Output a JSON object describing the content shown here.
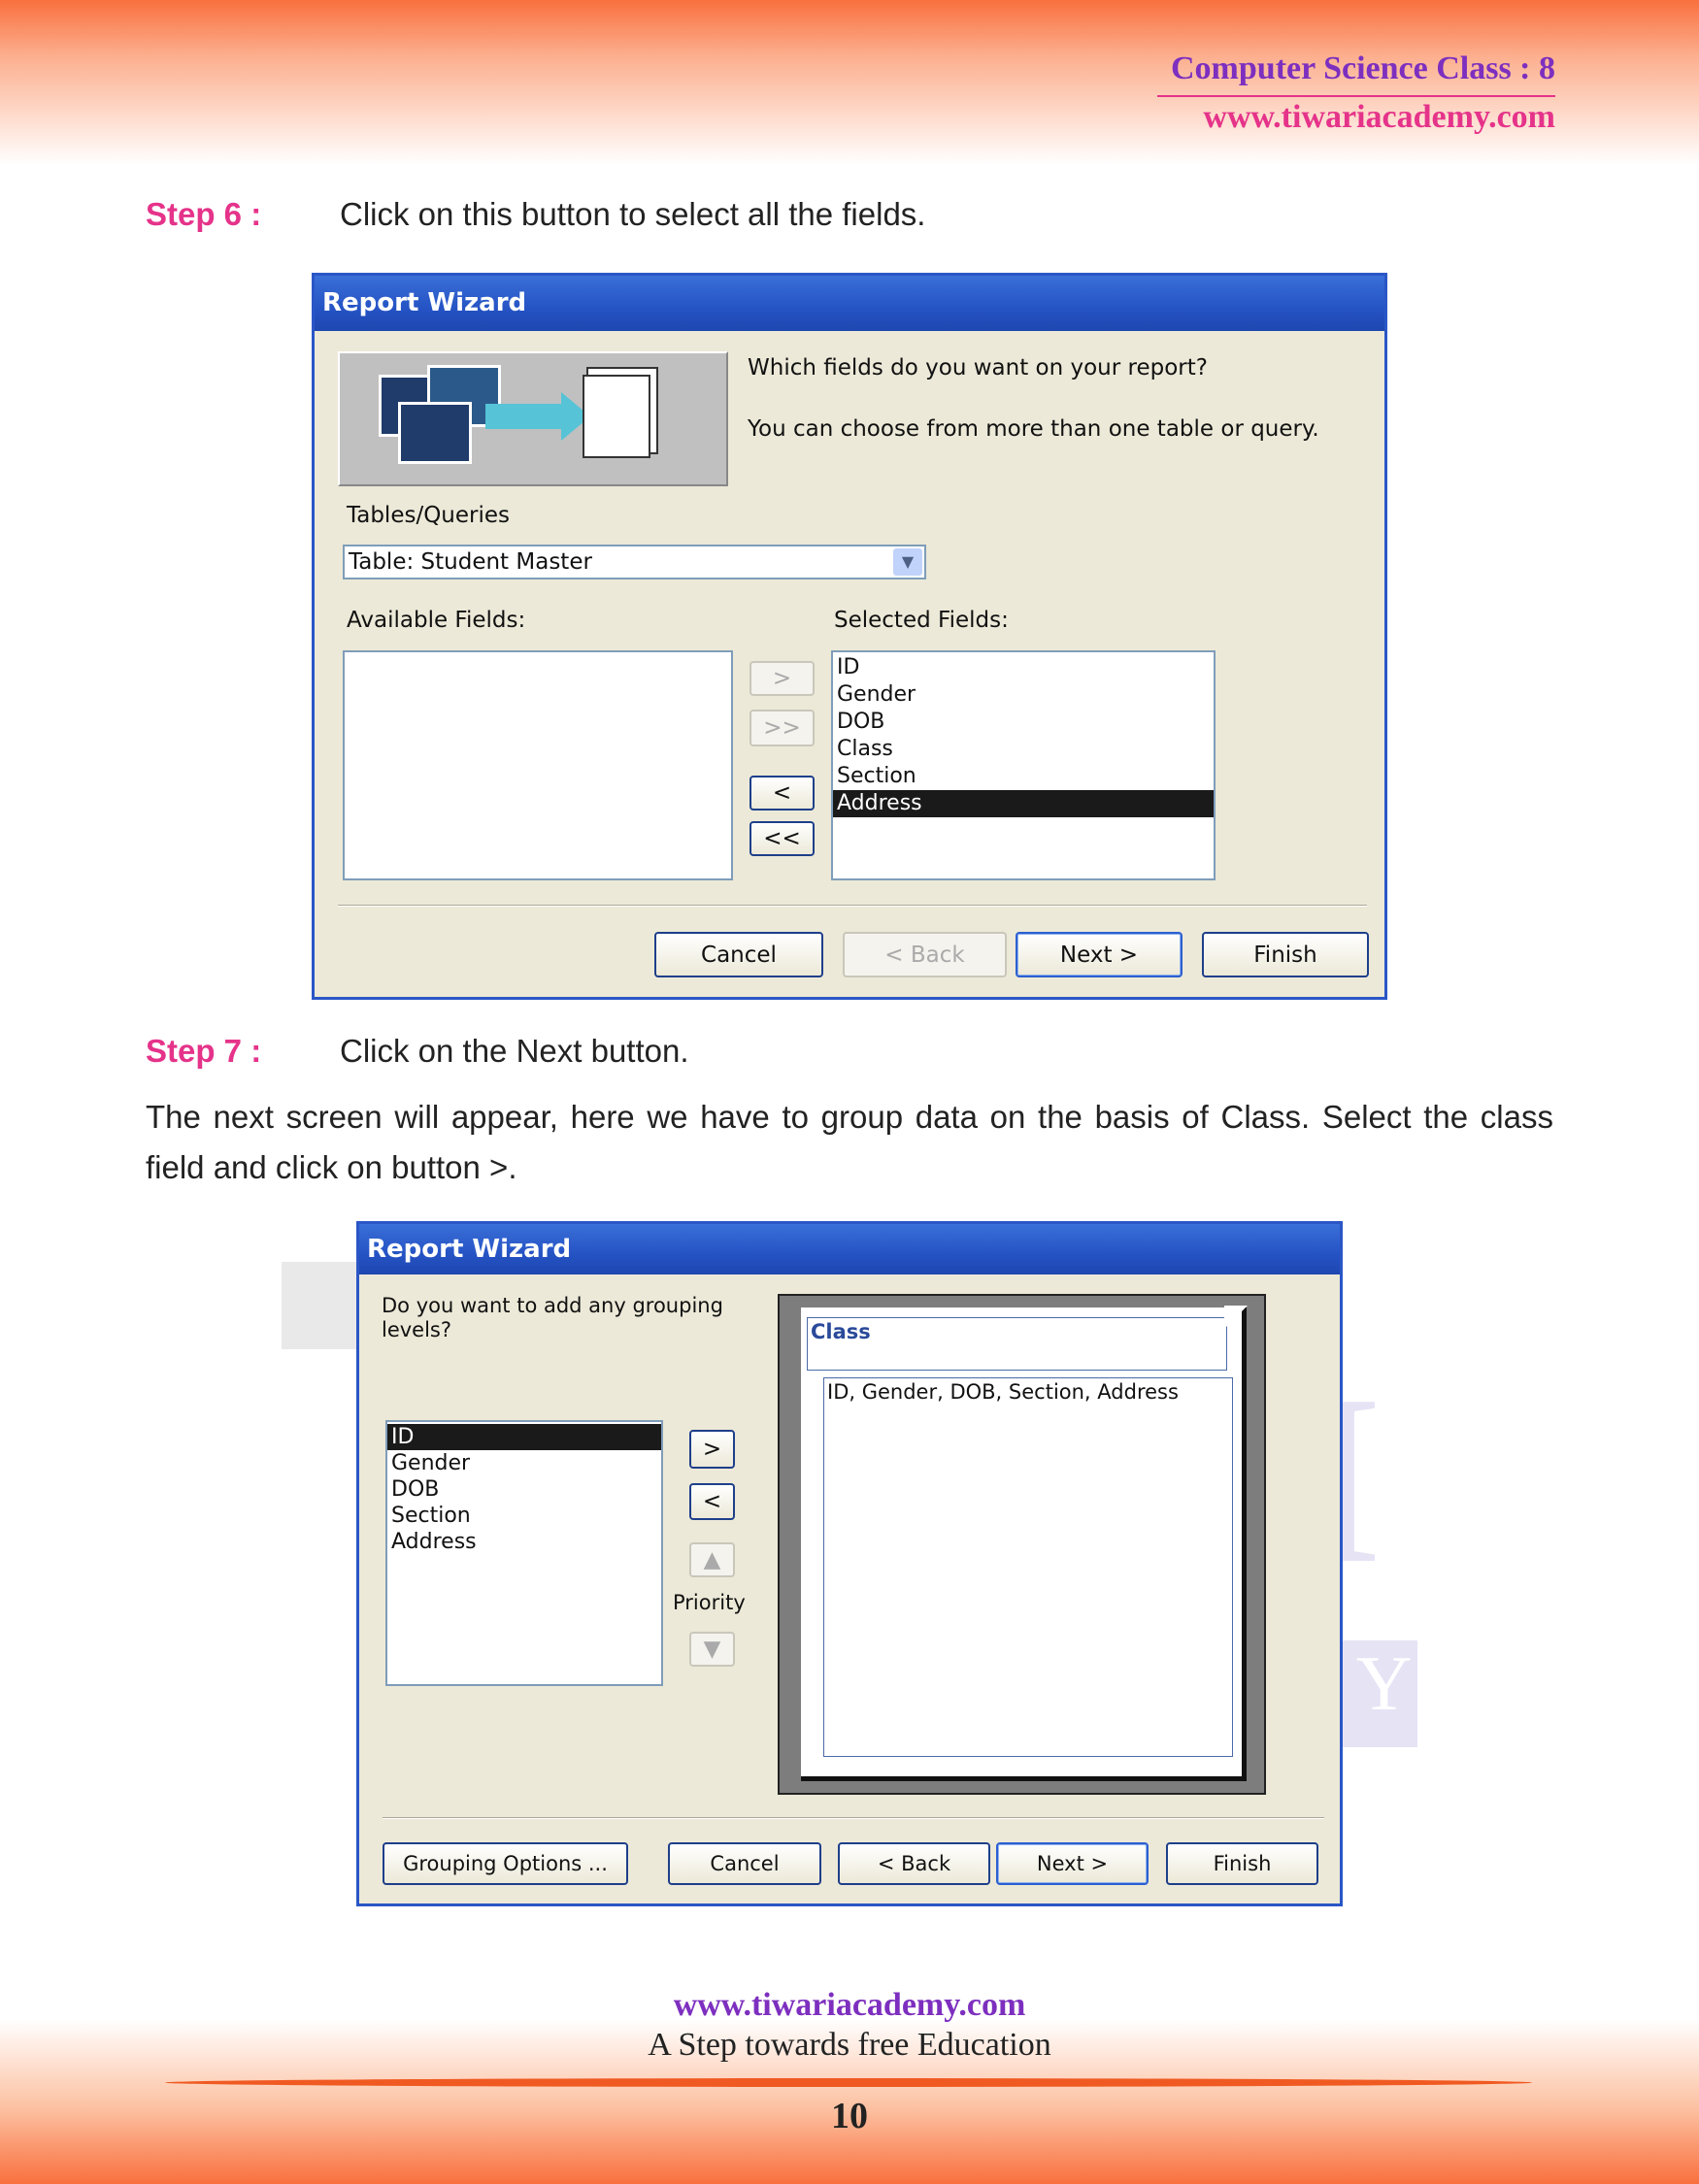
{
  "header": {
    "subject": "Computer Science Class : 8",
    "website": "www.tiwariacademy.com",
    "subject_color": "#7d2fbf",
    "website_color": "#e5338a"
  },
  "watermark": {
    "line1": "TIWARI",
    "line2": "ACADEMY"
  },
  "step6": {
    "label": "Step 6 :",
    "text": "Click on this button to select all the fields."
  },
  "dialog1": {
    "title": "Report Wizard",
    "question": "Which fields do you want on your report?",
    "hint": "You can choose from more than one table or query.",
    "tables_label": "Tables/Queries",
    "combo_value": "Table: Student Master",
    "available_label": "Available Fields:",
    "selected_label": "Selected Fields:",
    "available_fields": [],
    "selected_fields": [
      "ID",
      "Gender",
      "DOB",
      "Class",
      "Section",
      "Address"
    ],
    "selected_item": "Address",
    "btn_add": ">",
    "btn_add_all": ">>",
    "btn_remove": "<",
    "btn_remove_all": "<<",
    "cancel": "Cancel",
    "back": "< Back",
    "next": "Next >",
    "finish": "Finish"
  },
  "step7": {
    "label": "Step 7 :",
    "text": "Click on the Next button.",
    "paragraph": "The next screen will appear, here we have to group data on the basis of Class. Select the class field and click on button >."
  },
  "dialog2": {
    "title": "Report Wizard",
    "question": "Do you want to add any grouping levels?",
    "fields": [
      "ID",
      "Gender",
      "DOB",
      "Section",
      "Address"
    ],
    "selected_item": "ID",
    "btn_add": ">",
    "btn_remove": "<",
    "priority": "Priority",
    "preview_group": "Class",
    "preview_detail": "ID, Gender, DOB, Section, Address",
    "grouping_options": "Grouping Options ...",
    "cancel": "Cancel",
    "back": "< Back",
    "next": "Next >",
    "finish": "Finish"
  },
  "footer": {
    "website": "www.tiwariacademy.com",
    "tagline": "A Step towards free Education",
    "page_number": "10"
  }
}
